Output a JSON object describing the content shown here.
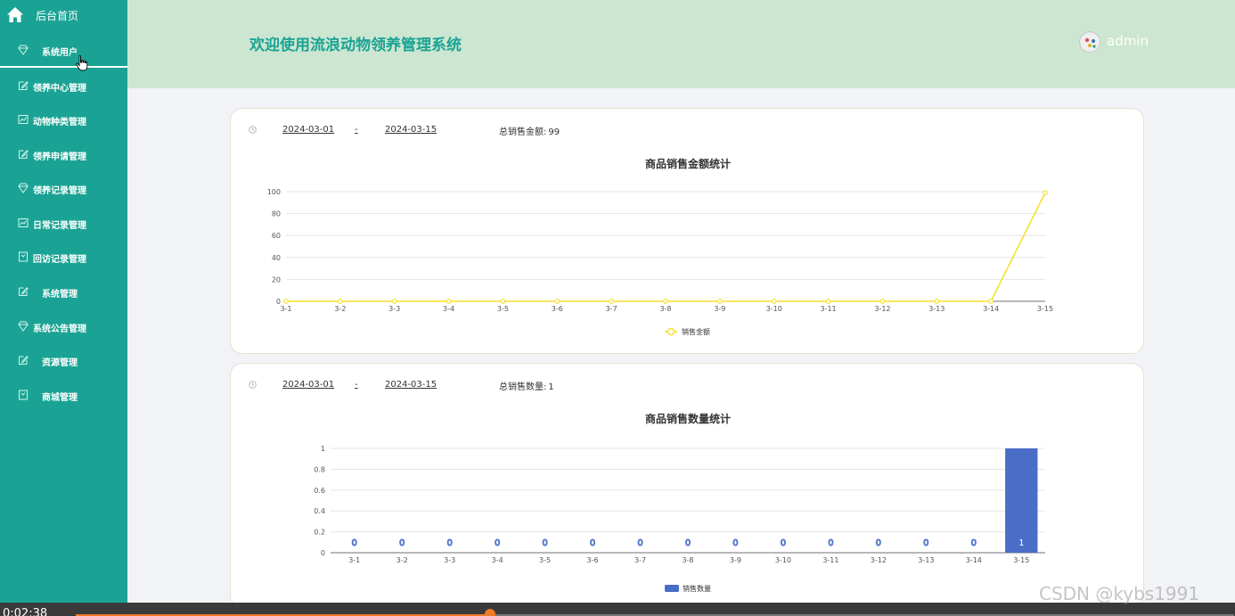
{
  "sidebar": {
    "home_label": "后台首页",
    "items": [
      {
        "label": "系统用户",
        "icon": "gem-icon",
        "active": true
      },
      {
        "label": "领养中心管理",
        "icon": "edit-icon"
      },
      {
        "label": "动物种类管理",
        "icon": "chart-icon"
      },
      {
        "label": "领养申请管理",
        "icon": "edit-icon"
      },
      {
        "label": "领养记录管理",
        "icon": "gem-icon"
      },
      {
        "label": "日常记录管理",
        "icon": "chart-icon"
      },
      {
        "label": "回访记录管理",
        "icon": "bookmark-icon"
      },
      {
        "label": "系统管理",
        "icon": "edit-icon"
      },
      {
        "label": "系统公告管理",
        "icon": "gem-icon"
      },
      {
        "label": "资源管理",
        "icon": "edit-icon"
      },
      {
        "label": "商城管理",
        "icon": "bookmark-icon"
      }
    ]
  },
  "header": {
    "title": "欢迎使用流浪动物领养管理系统",
    "user": "admin"
  },
  "card1": {
    "start_date": "2024-03-01",
    "separator": "-",
    "end_date": "2024-03-15",
    "total_label": "总销售金额:",
    "total_value": "99"
  },
  "card2": {
    "start_date": "2024-03-01",
    "separator": "-",
    "end_date": "2024-03-15",
    "total_label": "总销售数量:",
    "total_value": "1"
  },
  "chart_data": [
    {
      "type": "line",
      "title": "商品销售金额统计",
      "categories": [
        "3-1",
        "3-2",
        "3-3",
        "3-4",
        "3-5",
        "3-6",
        "3-7",
        "3-8",
        "3-9",
        "3-10",
        "3-11",
        "3-12",
        "3-13",
        "3-14",
        "3-15"
      ],
      "series": [
        {
          "name": "销售金额",
          "values": [
            0,
            0,
            0,
            0,
            0,
            0,
            0,
            0,
            0,
            0,
            0,
            0,
            0,
            0,
            99
          ]
        }
      ],
      "ylim": [
        0,
        100
      ],
      "yticks": [
        0,
        20,
        40,
        60,
        80,
        100
      ],
      "color": "#f5e12e",
      "grid": true,
      "legend": "bottom-center"
    },
    {
      "type": "bar",
      "title": "商品销售数量统计",
      "categories": [
        "3-1",
        "3-2",
        "3-3",
        "3-4",
        "3-5",
        "3-6",
        "3-7",
        "3-8",
        "3-9",
        "3-10",
        "3-11",
        "3-12",
        "3-13",
        "3-14",
        "3-15"
      ],
      "series": [
        {
          "name": "销售数量",
          "values": [
            0,
            0,
            0,
            0,
            0,
            0,
            0,
            0,
            0,
            0,
            0,
            0,
            0,
            0,
            1
          ]
        }
      ],
      "ylim": [
        0,
        1
      ],
      "yticks": [
        0,
        0.2,
        0.4,
        0.6,
        0.8,
        1
      ],
      "color": "#4a6ec8",
      "grid": true,
      "legend": "bottom-center",
      "data_labels": true
    }
  ],
  "video": {
    "time": "0:02:38",
    "progress": 0.358
  },
  "watermark": "CSDN @kybs1991"
}
